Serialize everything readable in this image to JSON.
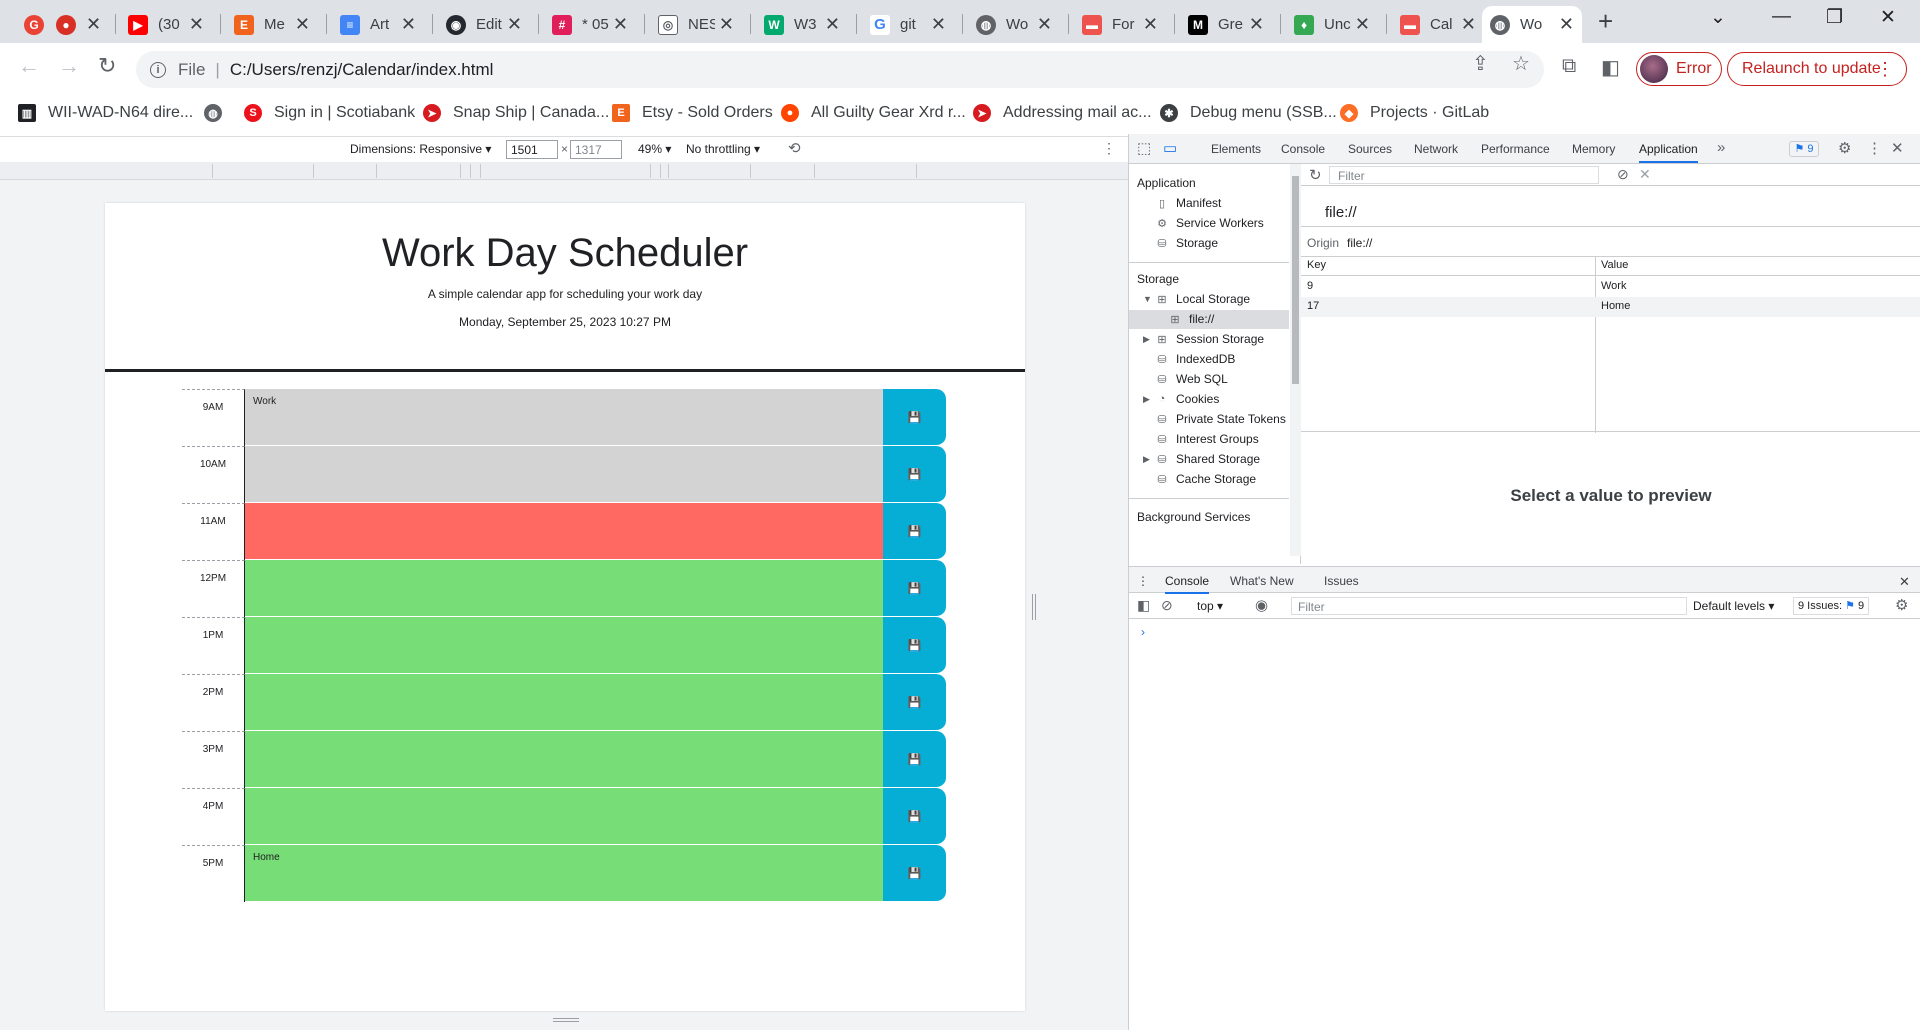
{
  "browser": {
    "tabs": [
      {
        "title": "",
        "icon": "google-account-icon",
        "color": "#ea4335"
      },
      {
        "title": "",
        "icon": "record-icon",
        "color": "#d93025"
      },
      {
        "title": "(30",
        "icon": "youtube-icon",
        "color": "#ff0000"
      },
      {
        "title": "Me",
        "icon": "etsy-icon",
        "color": "#f1641e"
      },
      {
        "title": "Art",
        "icon": "google-docs-icon",
        "color": "#4285f4"
      },
      {
        "title": "Edit",
        "icon": "github-icon",
        "color": "#24292f"
      },
      {
        "title": "* 05",
        "icon": "slack-icon",
        "color": "#e01e5a"
      },
      {
        "title": "NES",
        "icon": "controller-icon",
        "color": "#5f6368"
      },
      {
        "title": "W3",
        "icon": "w3schools-icon",
        "color": "#04aa6d"
      },
      {
        "title": "git",
        "icon": "google-icon",
        "color": "#4285f4"
      },
      {
        "title": "Wo",
        "icon": "globe-icon",
        "color": "#5f6368"
      },
      {
        "title": "For",
        "icon": "bootcamp-icon",
        "color": "#ef5350"
      },
      {
        "title": "Gre",
        "icon": "medium-icon",
        "color": "#000000"
      },
      {
        "title": "Unc",
        "icon": "uncommon-icon",
        "color": "#34a853"
      },
      {
        "title": "Cal",
        "icon": "bootcamp-icon",
        "color": "#ef5350"
      },
      {
        "title": "Wo",
        "icon": "globe-icon",
        "color": "#5f6368"
      }
    ],
    "url_scheme": "File",
    "url": "C:/Users/renzj/Calendar/index.html",
    "error_label": "Error",
    "relaunch_label": "Relaunch to update",
    "bookmarks": [
      {
        "label": "WII-WAD-N64 dire...",
        "color": "#202124"
      },
      {
        "label": "",
        "color": "#5f6368"
      },
      {
        "label": "Sign in | Scotiabank",
        "color": "#ec111a"
      },
      {
        "label": "Snap Ship | Canada...",
        "color": "#d71920"
      },
      {
        "label": "Etsy - Sold Orders",
        "color": "#f1641e"
      },
      {
        "label": "All Guilty Gear Xrd r...",
        "color": "#ff4500"
      },
      {
        "label": "Addressing mail ac...",
        "color": "#d71920"
      },
      {
        "label": "Debug menu (SSB...",
        "color": "#3c4043"
      },
      {
        "label": "Projects · GitLab",
        "color": "#fc6d26"
      }
    ]
  },
  "devbar": {
    "dimensions": "Dimensions: Responsive",
    "width": "1501",
    "height": "1317",
    "zoom": "49%",
    "throttle": "No throttling"
  },
  "page": {
    "title": "Work Day Scheduler",
    "subtitle": "A simple calendar app for scheduling your work day",
    "date": "Monday, September 25, 2023 10:27 PM",
    "hours": [
      {
        "label": "9AM",
        "text": "Work",
        "state": "past"
      },
      {
        "label": "10AM",
        "text": "",
        "state": "past"
      },
      {
        "label": "11AM",
        "text": "",
        "state": "present"
      },
      {
        "label": "12PM",
        "text": "",
        "state": "future"
      },
      {
        "label": "1PM",
        "text": "",
        "state": "future"
      },
      {
        "label": "2PM",
        "text": "",
        "state": "future"
      },
      {
        "label": "3PM",
        "text": "",
        "state": "future"
      },
      {
        "label": "4PM",
        "text": "",
        "state": "future"
      },
      {
        "label": "5PM",
        "text": "Home",
        "state": "future"
      }
    ]
  },
  "devtools": {
    "tabs": [
      "Elements",
      "Console",
      "Sources",
      "Network",
      "Performance",
      "Memory",
      "Application"
    ],
    "issues_count": "9",
    "side": {
      "application_header": "Application",
      "manifest": "Manifest",
      "service_workers": "Service Workers",
      "storage": "Storage",
      "storage_header": "Storage",
      "local_storage": "Local Storage",
      "file_origin": "file://",
      "session_storage": "Session Storage",
      "indexeddb": "IndexedDB",
      "websql": "Web SQL",
      "cookies": "Cookies",
      "private_state_tokens": "Private State Tokens",
      "interest_groups": "Interest Groups",
      "shared_storage": "Shared Storage",
      "cache_storage": "Cache Storage",
      "background_header": "Background Services"
    },
    "filter_placeholder": "Filter",
    "origin_heading": "file://",
    "origin_label": "Origin",
    "origin_value": "file://",
    "table": {
      "key_header": "Key",
      "value_header": "Value",
      "rows": [
        {
          "key": "9",
          "value": "Work"
        },
        {
          "key": "17",
          "value": "Home"
        }
      ]
    },
    "preview_text": "Select a value to preview",
    "drawer": {
      "tabs": [
        "Console",
        "What's New",
        "Issues"
      ],
      "context": "top",
      "filter_placeholder": "Filter",
      "levels": "Default levels",
      "issues": "9 Issues:",
      "issues_count": "9"
    }
  }
}
